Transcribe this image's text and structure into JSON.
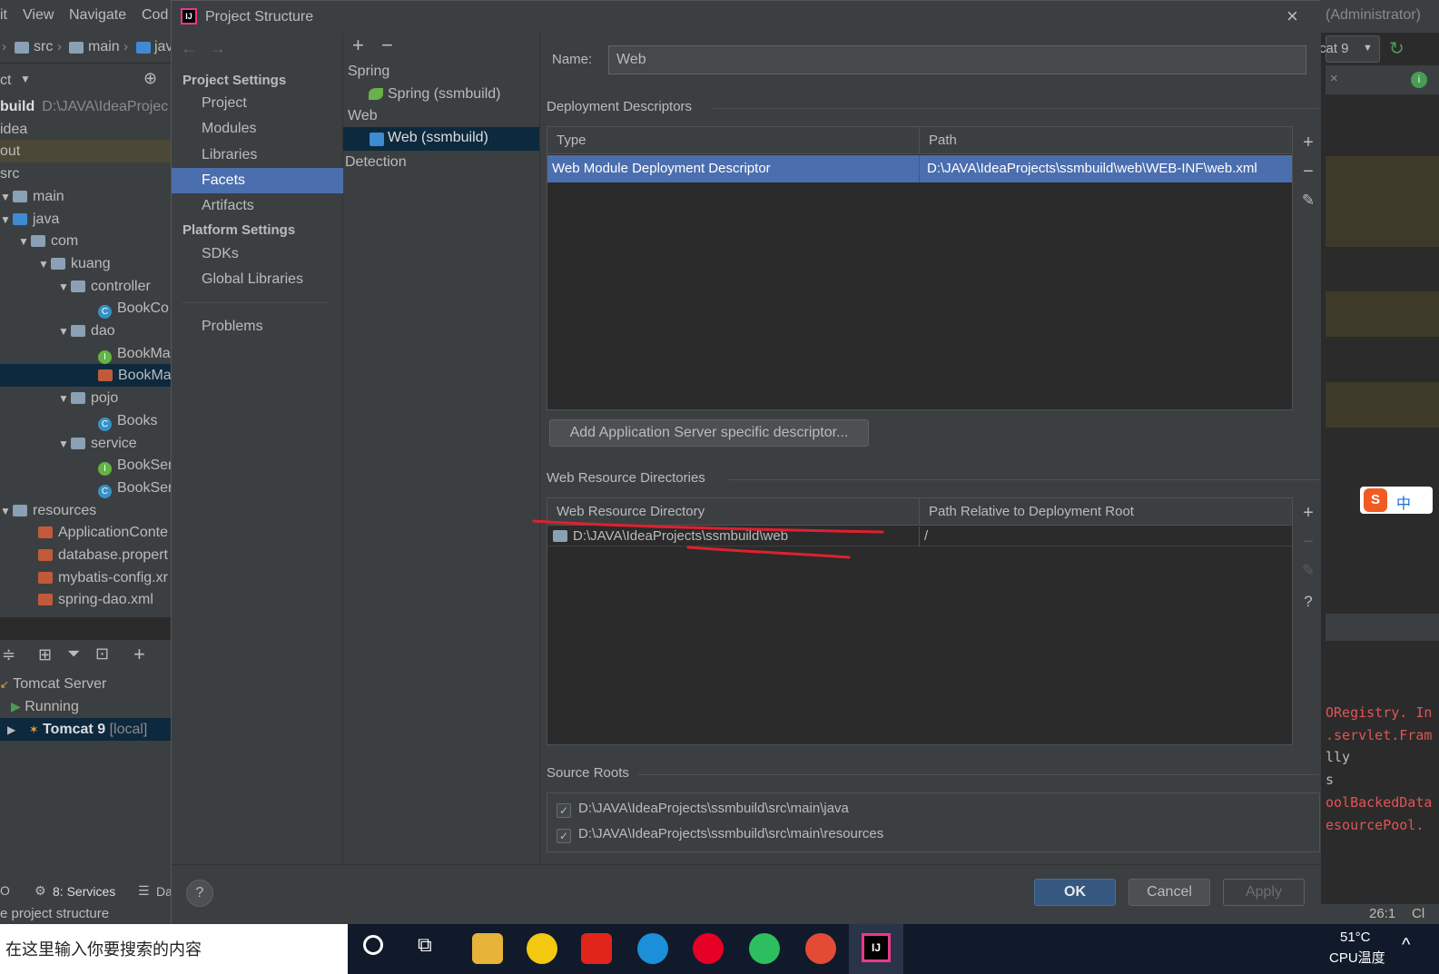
{
  "ide": {
    "menu": [
      "it",
      "View",
      "Navigate",
      "Cod"
    ],
    "admin_label": "(Administrator)",
    "breadcrumb": [
      "src",
      "main",
      "jav"
    ],
    "project_dropdown": "ct",
    "run_config": "cat 9",
    "tree": [
      {
        "label": "build",
        "extra": "D:\\JAVA\\IdeaProjec",
        "bold": true
      },
      {
        "label": "idea"
      },
      {
        "label": "out"
      },
      {
        "label": "src"
      },
      {
        "label": "main"
      },
      {
        "label": "java"
      },
      {
        "label": "com"
      },
      {
        "label": "kuang"
      },
      {
        "label": "controller"
      },
      {
        "label": "BookCo"
      },
      {
        "label": "dao"
      },
      {
        "label": "BookMa"
      },
      {
        "label": "BookMa"
      },
      {
        "label": "pojo"
      },
      {
        "label": "Books"
      },
      {
        "label": "service"
      },
      {
        "label": "BookSer"
      },
      {
        "label": "BookSer"
      },
      {
        "label": "resources"
      },
      {
        "label": "ApplicationConte"
      },
      {
        "label": "database.propert"
      },
      {
        "label": "mybatis-config.xr"
      },
      {
        "label": "spring-dao.xml"
      }
    ],
    "services": {
      "tomcat_server": "Tomcat Server",
      "running": "Running",
      "tomcat9": "Tomcat 9",
      "local": "[local]"
    },
    "bottom_tabs": {
      "first": "O",
      "services": "8: Services",
      "db": "Da"
    },
    "status_text": "e project structure",
    "status_pos": "26:1",
    "status_extra": "Cl",
    "console_lines": [
      "ORegistry. In",
      ".servlet.Fram",
      "lly",
      "s",
      "oolBackedData",
      "esourcePool."
    ]
  },
  "dialog": {
    "title": "Project Structure",
    "project_settings_header": "Project Settings",
    "project_settings_items": [
      "Project",
      "Modules",
      "Libraries",
      "Facets",
      "Artifacts"
    ],
    "platform_settings_header": "Platform Settings",
    "platform_settings_items": [
      "SDKs",
      "Global Libraries"
    ],
    "problems": "Problems",
    "facets": {
      "spring_group": "Spring",
      "spring_item": "Spring (ssmbuild)",
      "web_group": "Web",
      "web_item": "Web (ssmbuild)",
      "detection": "Detection"
    },
    "name_label": "Name:",
    "name_value": "Web",
    "deployment_descriptors": {
      "title": "Deployment Descriptors",
      "col_type": "Type",
      "col_path": "Path",
      "row_type": "Web Module Deployment Descriptor",
      "row_path": "D:\\JAVA\\IdeaProjects\\ssmbuild\\web\\WEB-INF\\web.xml",
      "add_button": "Add Application Server specific descriptor..."
    },
    "web_resource_dirs": {
      "title": "Web Resource Directories",
      "col_dir": "Web Resource Directory",
      "col_rel": "Path Relative to Deployment Root",
      "row_dir": "D:\\JAVA\\IdeaProjects\\ssmbuild\\web",
      "row_rel": "/"
    },
    "source_roots": {
      "title": "Source Roots",
      "items": [
        "D:\\JAVA\\IdeaProjects\\ssmbuild\\src\\main\\java",
        "D:\\JAVA\\IdeaProjects\\ssmbuild\\src\\main\\resources"
      ]
    },
    "buttons": {
      "ok": "OK",
      "cancel": "Cancel",
      "apply": "Apply"
    }
  },
  "taskbar": {
    "search_placeholder": "在这里输入你要搜索的内容",
    "temp": "51°C",
    "cpu": "CPU温度"
  },
  "ime": {
    "label": "中"
  },
  "colors": {
    "selection": "#4b6eaf",
    "tree_selection": "#0d293e",
    "annotation": "#e0202e",
    "ok_button": "#365880"
  }
}
